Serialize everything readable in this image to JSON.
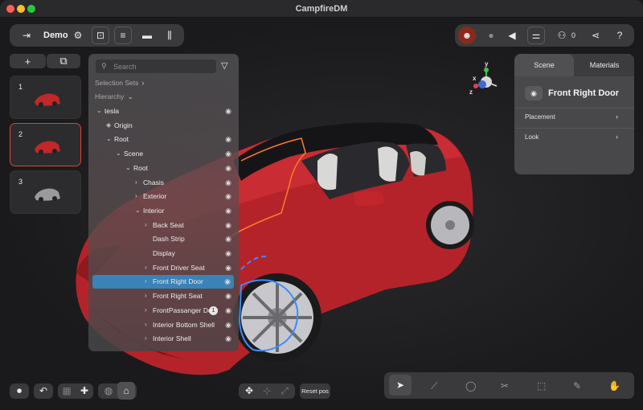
{
  "window": {
    "title": "CampfireDM"
  },
  "top_left_toolbar": {
    "project_name": "Demo",
    "icons": [
      "exit-icon",
      "gear-icon",
      "briefcase-icon",
      "menu-lines-icon",
      "folder-icon",
      "library-icon"
    ]
  },
  "top_right_toolbar": {
    "participant_count": "0",
    "icons": [
      "avatar-icon",
      "microphone-icon",
      "speaker-icon",
      "settings-sliders-icon",
      "participants-icon",
      "share-icon",
      "help-icon"
    ]
  },
  "left_sidebar": {
    "add_label": "+",
    "duplicate_label": "⧉",
    "slides": [
      {
        "number": "1",
        "active": false,
        "car_color": "#c0282a"
      },
      {
        "number": "2",
        "active": true,
        "car_color": "#c0282a"
      },
      {
        "number": "3",
        "active": false,
        "car_color": "#9a9a9a"
      }
    ]
  },
  "hierarchy_panel": {
    "search_placeholder": "Search",
    "selection_sets_label": "Selection Sets",
    "selection_sets_chevron": "›",
    "hierarchy_label": "Hierarchy",
    "hierarchy_chevron": "⌄",
    "rows": [
      {
        "label": "tesla",
        "chevron": "⌄",
        "eye": true
      },
      {
        "label": "Origin",
        "chevron": "◈",
        "eye": false
      },
      {
        "label": "Root",
        "chevron": "⌄",
        "eye": true
      },
      {
        "label": "Scene",
        "chevron": "⌄",
        "eye": true
      },
      {
        "label": "Root",
        "chevron": "⌄",
        "eye": true
      },
      {
        "label": "Chasis",
        "chevron": "›",
        "eye": true
      },
      {
        "label": "Exterior",
        "chevron": "›",
        "eye": true
      },
      {
        "label": "Interior",
        "chevron": "⌄",
        "eye": true
      },
      {
        "label": "Back Seat",
        "chevron": "›",
        "eye": true
      },
      {
        "label": "Dash Strip",
        "chevron": "",
        "eye": true
      },
      {
        "label": "Display",
        "chevron": "",
        "eye": true
      },
      {
        "label": "Front Driver Seat",
        "chevron": "›",
        "eye": true
      },
      {
        "label": "Front Right Door",
        "chevron": "›",
        "eye": true,
        "selected": true
      },
      {
        "label": "Front Right Seat",
        "chevron": "›",
        "eye": true
      },
      {
        "label": "FrontPassanger Door",
        "chevron": "›",
        "eye": true,
        "badge": "1"
      },
      {
        "label": "Interior Bottom Shell",
        "chevron": "›",
        "eye": true
      },
      {
        "label": "Interior Shell",
        "chevron": "›",
        "eye": true
      }
    ]
  },
  "properties_panel": {
    "tabs": [
      "Scene",
      "Materials"
    ],
    "active_tab": "Scene",
    "object_name": "Front Right Door",
    "sections": [
      {
        "label": "Placement",
        "chevron": "›"
      },
      {
        "label": "Look",
        "chevron": "›"
      }
    ]
  },
  "gizmo": {
    "x_label": "x",
    "y_label": "y",
    "z_label": "z"
  },
  "bottom_left_toolbar": {
    "icons": [
      "camera-icon",
      "undo-icon",
      "grid-icon",
      "puzzle-icon",
      "globe-icon",
      "home-icon"
    ]
  },
  "bottom_center_toolbar": {
    "icons": [
      "move-icon",
      "rotate-icon",
      "scale-icon"
    ],
    "reset_label": "Reset pos"
  },
  "bottom_right_toolbar": {
    "icons": [
      "pointer-icon",
      "laser-icon",
      "comment-icon",
      "scissors-icon",
      "screenshot-icon",
      "pen-icon",
      "hand-icon"
    ],
    "active_tool": "pointer-icon"
  },
  "colors": {
    "accent_selected": "#3a82b8",
    "active_slide_border": "#e0403a",
    "car_body": "#c0282a",
    "door_outline": "#3a8cff",
    "edge_highlight": "#ff7a2a"
  }
}
